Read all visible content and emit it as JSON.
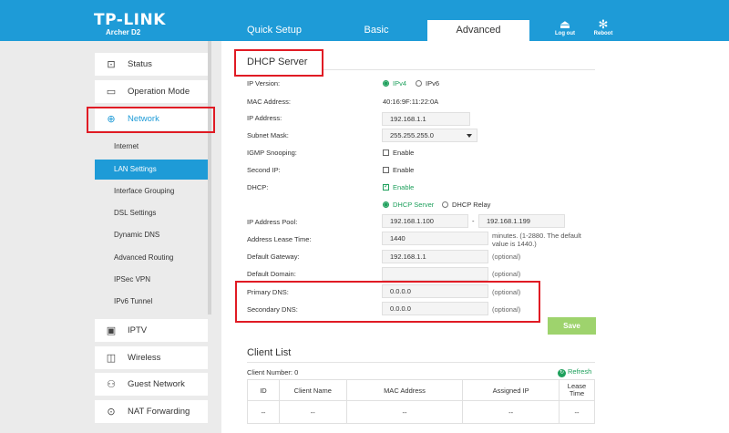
{
  "header": {
    "logo": "TP-LINK",
    "model": "Archer D2",
    "tabs": [
      {
        "label": "Quick Setup"
      },
      {
        "label": "Basic"
      },
      {
        "label": "Advanced"
      }
    ],
    "logout_label": "Log out",
    "reboot_label": "Reboot"
  },
  "sidebar": {
    "menu": [
      {
        "label": "Status",
        "icon": "status-icon"
      },
      {
        "label": "Operation Mode",
        "icon": "monitor-icon"
      },
      {
        "label": "Network",
        "icon": "globe-icon"
      },
      {
        "label": "IPTV",
        "icon": "tv-icon"
      },
      {
        "label": "Wireless",
        "icon": "wireless-icon"
      },
      {
        "label": "Guest Network",
        "icon": "guest-icon"
      },
      {
        "label": "NAT Forwarding",
        "icon": "nat-icon"
      }
    ],
    "network_sub": [
      "Internet",
      "LAN Settings",
      "Interface Grouping",
      "DSL Settings",
      "Dynamic DNS",
      "Advanced Routing",
      "IPSec VPN",
      "IPv6 Tunnel"
    ]
  },
  "dhcp": {
    "title": "DHCP Server",
    "ip_version_label": "IP Version:",
    "ipv4": "IPv4",
    "ipv6": "IPv6",
    "mac_label": "MAC Address:",
    "mac": "40:16:9F:11:22:0A",
    "ip_label": "IP Address:",
    "ip": "192.168.1.1",
    "subnet_label": "Subnet Mask:",
    "subnet": "255.255.255.0",
    "igmp_label": "IGMP Snooping:",
    "second_ip_label": "Second IP:",
    "enable": "Enable",
    "dhcp_label": "DHCP:",
    "dhcp_server_opt": "DHCP Server",
    "dhcp_relay_opt": "DHCP Relay",
    "pool_label": "IP Address Pool:",
    "pool_start": "192.168.1.100",
    "pool_dash": "-",
    "pool_end": "192.168.1.199",
    "lease_label": "Address Lease Time:",
    "lease": "1440",
    "lease_note_1": "minutes. (1-2880. The default",
    "lease_note_2": "value is 1440.)",
    "gateway_label": "Default Gateway:",
    "gateway": "192.168.1.1",
    "domain_label": "Default Domain:",
    "domain": "",
    "primary_dns_label": "Primary DNS:",
    "primary_dns": "0.0.0.0",
    "secondary_dns_label": "Secondary DNS:",
    "secondary_dns": "0.0.0.0",
    "optional": "(optional)",
    "save": "Save"
  },
  "client_list": {
    "title": "Client List",
    "count_label": "Client Number: 0",
    "refresh": "Refresh",
    "columns": [
      "ID",
      "Client Name",
      "MAC Address",
      "Assigned IP",
      "Lease Time"
    ],
    "row": [
      "--",
      "--",
      "--",
      "--",
      "--"
    ]
  },
  "colors": {
    "brand": "#1e9bd7",
    "accent_green": "#1ea05c",
    "highlight_red": "#e01b24"
  }
}
